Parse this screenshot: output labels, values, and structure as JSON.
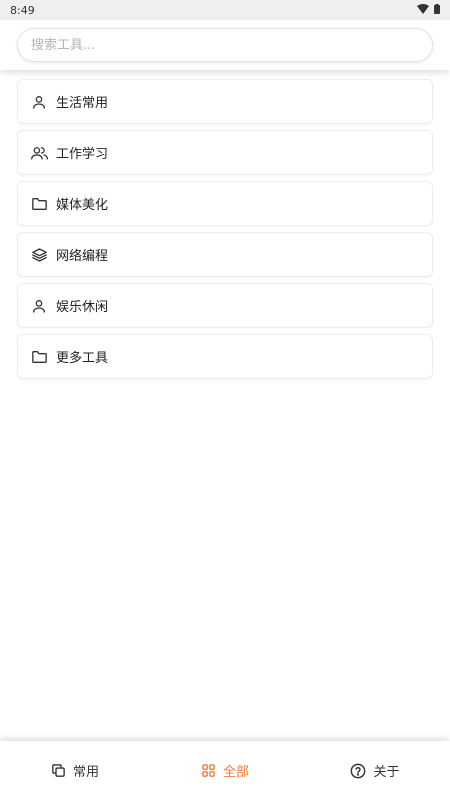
{
  "status_bar": {
    "time": "8:49",
    "icons": [
      "wifi-icon",
      "battery-icon"
    ]
  },
  "search": {
    "placeholder": "搜索工具..."
  },
  "categories": [
    {
      "label": "生活常用",
      "icon": "user-icon"
    },
    {
      "label": "工作学习",
      "icon": "users-icon"
    },
    {
      "label": "媒体美化",
      "icon": "folder-icon"
    },
    {
      "label": "网络编程",
      "icon": "layers-icon"
    },
    {
      "label": "娱乐休闲",
      "icon": "user-icon"
    },
    {
      "label": "更多工具",
      "icon": "folder-icon"
    }
  ],
  "bottom_nav": {
    "items": [
      {
        "label": "常用",
        "icon": "copy-icon",
        "active": false
      },
      {
        "label": "全部",
        "icon": "grid-icon",
        "active": true
      },
      {
        "label": "关于",
        "icon": "help-circle-icon",
        "active": false
      }
    ],
    "active_color": "#f07a3c"
  }
}
